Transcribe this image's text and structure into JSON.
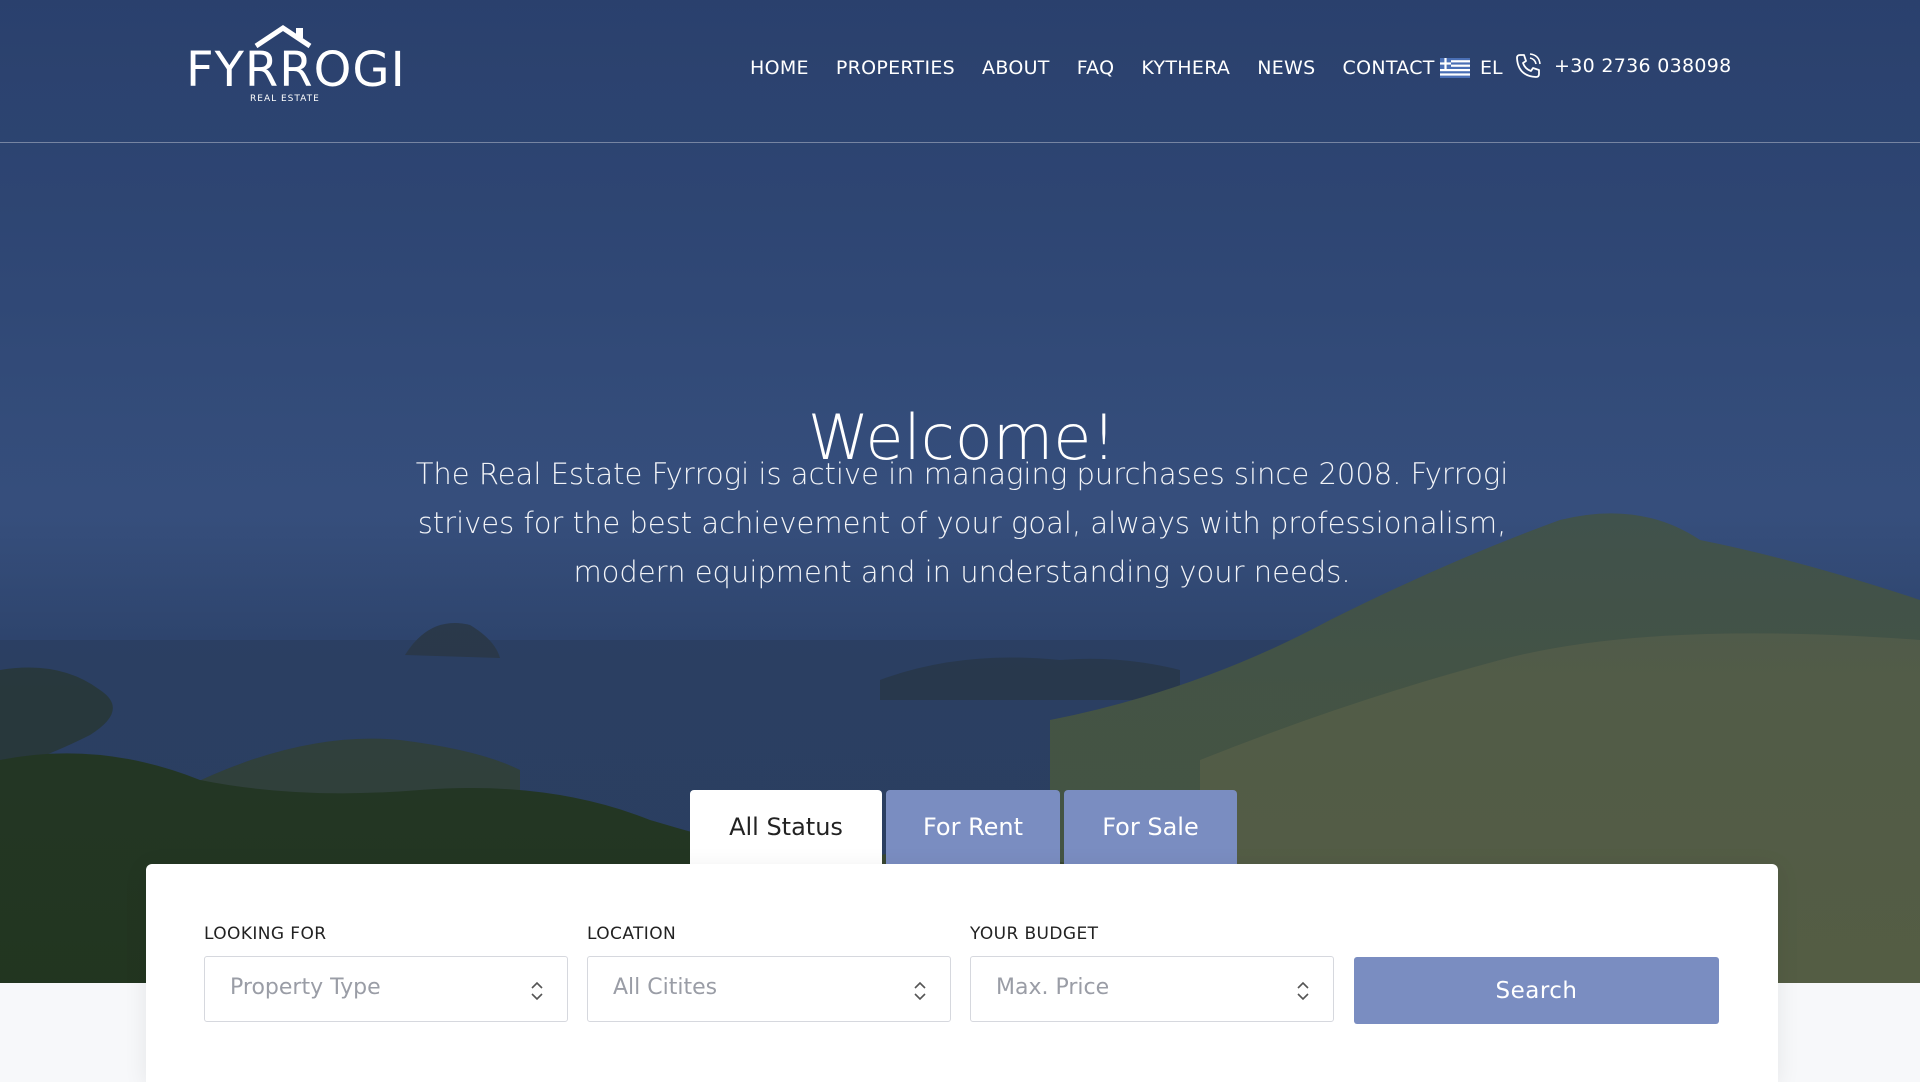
{
  "brand": {
    "name": "FYRROGI",
    "tagline": "REAL ESTATE"
  },
  "nav": {
    "items": [
      {
        "label": "HOME"
      },
      {
        "label": "PROPERTIES"
      },
      {
        "label": "ABOUT"
      },
      {
        "label": "FAQ"
      },
      {
        "label": "KYTHERA"
      },
      {
        "label": "NEWS"
      },
      {
        "label": "CONTACT"
      }
    ]
  },
  "language": {
    "label": "EL",
    "flag_icon": "greek-flag-icon"
  },
  "contact": {
    "phone": "+30 2736 038098",
    "phone_icon": "phone-icon"
  },
  "hero": {
    "title": "Welcome!",
    "description": "The Real Estate Fyrrogi is active in managing purchases since 2008. Fyrrogi strives for the best achievement of your goal, always with professionalism, modern equipment and in understanding your needs."
  },
  "search": {
    "tabs": [
      {
        "label": "All Status",
        "active": true
      },
      {
        "label": "For Rent",
        "active": false
      },
      {
        "label": "For Sale",
        "active": false
      }
    ],
    "fields": [
      {
        "label": "LOOKING FOR",
        "value": "Property Type"
      },
      {
        "label": "LOCATION",
        "value": "All Citites"
      },
      {
        "label": "YOUR BUDGET",
        "value": "Max. Price"
      }
    ],
    "button_label": "Search"
  },
  "colors": {
    "accent": "#7a8dc1",
    "header_bg": "#2f4672",
    "panel_bg": "#ffffff"
  }
}
